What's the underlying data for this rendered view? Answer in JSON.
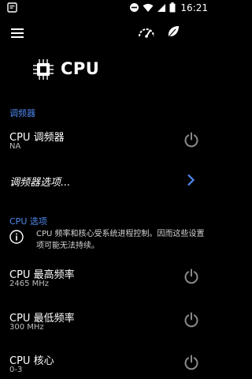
{
  "status_bar": {
    "time": "16:21"
  },
  "toolbar": {
    "menu_icon": "hamburger-menu-icon",
    "actions": [
      "speedometer-icon",
      "leaf-icon"
    ]
  },
  "header": {
    "icon": "cpu-chip-icon",
    "title": "CPU"
  },
  "sections": {
    "governor": {
      "header": "调频器",
      "cpu_governor": {
        "title": "CPU 调频器",
        "value": "NA"
      },
      "governor_options": {
        "title": "调频器选项..."
      }
    },
    "cpu_options": {
      "header": "CPU 选项",
      "notice": "CPU 频率和核心受系统进程控制。因而这些设置项可能无法持续。",
      "max_freq": {
        "title": "CPU 最高频率",
        "value": "2465 MHz"
      },
      "min_freq": {
        "title": "CPU 最低频率",
        "value": "300 MHz"
      },
      "cores": {
        "title": "CPU 核心",
        "value": "0-3"
      }
    }
  },
  "colors": {
    "accent": "#4f88ef",
    "background": "#000000",
    "secondary_text": "#bdbdbd",
    "icon_gray": "#8a8a8a"
  }
}
